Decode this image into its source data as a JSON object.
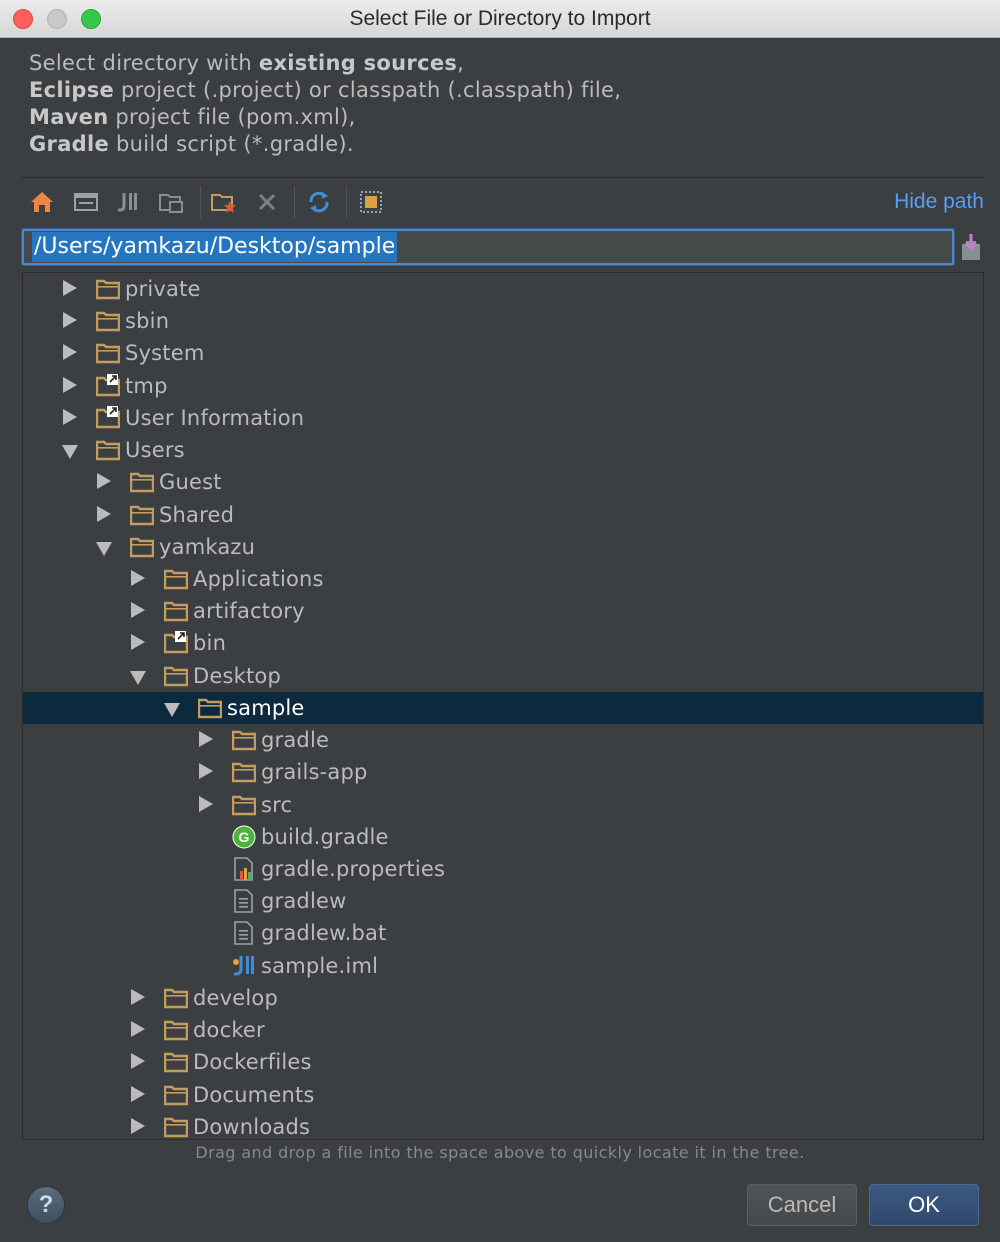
{
  "window": {
    "title": "Select File or Directory to Import"
  },
  "description": {
    "lines": [
      {
        "bold": "",
        "text": "Select directory with ",
        "bold_after": "existing sources",
        "tail": ","
      },
      {
        "bold": "Eclipse",
        "text": " project (.project) or classpath (.classpath) file,",
        "bold_after": "",
        "tail": ""
      },
      {
        "bold": "Maven",
        "text": " project file (pom.xml),",
        "bold_after": "",
        "tail": ""
      },
      {
        "bold": "Gradle",
        "text": " build script (*.gradle).",
        "bold_after": "",
        "tail": ""
      }
    ]
  },
  "toolbar": {
    "icons": [
      "home-icon",
      "desktop-icon",
      "project-icon",
      "module-icon",
      "new-folder-icon",
      "delete-icon",
      "refresh-icon",
      "show-hidden-icon"
    ],
    "hide_path_label": "Hide path"
  },
  "path": {
    "value": "/Users/yamkazu/Desktop/sample"
  },
  "tree": {
    "rows": [
      {
        "label": "private",
        "depth": 0,
        "expander": "collapsed",
        "icon": "folder-icon",
        "selected": false
      },
      {
        "label": "sbin",
        "depth": 0,
        "expander": "collapsed",
        "icon": "folder-icon",
        "selected": false
      },
      {
        "label": "System",
        "depth": 0,
        "expander": "collapsed",
        "icon": "folder-icon",
        "selected": false
      },
      {
        "label": "tmp",
        "depth": 0,
        "expander": "collapsed",
        "icon": "folder-link-icon",
        "selected": false
      },
      {
        "label": "User Information",
        "depth": 0,
        "expander": "collapsed",
        "icon": "folder-link-icon",
        "selected": false
      },
      {
        "label": "Users",
        "depth": 0,
        "expander": "expanded",
        "icon": "folder-icon",
        "selected": false
      },
      {
        "label": "Guest",
        "depth": 1,
        "expander": "collapsed",
        "icon": "folder-icon",
        "selected": false
      },
      {
        "label": "Shared",
        "depth": 1,
        "expander": "collapsed",
        "icon": "folder-icon",
        "selected": false
      },
      {
        "label": "yamkazu",
        "depth": 1,
        "expander": "expanded",
        "icon": "folder-icon",
        "selected": false
      },
      {
        "label": "Applications",
        "depth": 2,
        "expander": "collapsed",
        "icon": "folder-icon",
        "selected": false
      },
      {
        "label": "artifactory",
        "depth": 2,
        "expander": "collapsed",
        "icon": "folder-icon",
        "selected": false
      },
      {
        "label": "bin",
        "depth": 2,
        "expander": "collapsed",
        "icon": "folder-link-icon",
        "selected": false
      },
      {
        "label": "Desktop",
        "depth": 2,
        "expander": "expanded",
        "icon": "folder-icon",
        "selected": false
      },
      {
        "label": "sample",
        "depth": 3,
        "expander": "expanded",
        "icon": "folder-icon",
        "selected": true
      },
      {
        "label": "gradle",
        "depth": 4,
        "expander": "collapsed",
        "icon": "folder-icon",
        "selected": false
      },
      {
        "label": "grails-app",
        "depth": 4,
        "expander": "collapsed",
        "icon": "folder-icon",
        "selected": false
      },
      {
        "label": "src",
        "depth": 4,
        "expander": "collapsed",
        "icon": "folder-icon",
        "selected": false
      },
      {
        "label": "build.gradle",
        "depth": 4,
        "expander": "none",
        "icon": "gradle-file-icon",
        "selected": false
      },
      {
        "label": "gradle.properties",
        "depth": 4,
        "expander": "none",
        "icon": "properties-file-icon",
        "selected": false
      },
      {
        "label": "gradlew",
        "depth": 4,
        "expander": "none",
        "icon": "text-file-icon",
        "selected": false
      },
      {
        "label": "gradlew.bat",
        "depth": 4,
        "expander": "none",
        "icon": "text-file-icon",
        "selected": false
      },
      {
        "label": "sample.iml",
        "depth": 4,
        "expander": "none",
        "icon": "iml-file-icon",
        "selected": false
      },
      {
        "label": "develop",
        "depth": 2,
        "expander": "collapsed",
        "icon": "folder-icon",
        "selected": false
      },
      {
        "label": "docker",
        "depth": 2,
        "expander": "collapsed",
        "icon": "folder-icon",
        "selected": false
      },
      {
        "label": "Dockerfiles",
        "depth": 2,
        "expander": "collapsed",
        "icon": "folder-icon",
        "selected": false
      },
      {
        "label": "Documents",
        "depth": 2,
        "expander": "collapsed",
        "icon": "folder-icon",
        "selected": false
      },
      {
        "label": "Downloads",
        "depth": 2,
        "expander": "collapsed",
        "icon": "folder-icon",
        "selected": false
      }
    ]
  },
  "hint": "Drag and drop a file into the space above to quickly locate it in the tree.",
  "buttons": {
    "help": "?",
    "cancel": "Cancel",
    "ok": "OK"
  },
  "colors": {
    "background": "#3c3f41",
    "selection": "#0d293e",
    "link": "#589df6",
    "folder": "#c29d5f"
  }
}
